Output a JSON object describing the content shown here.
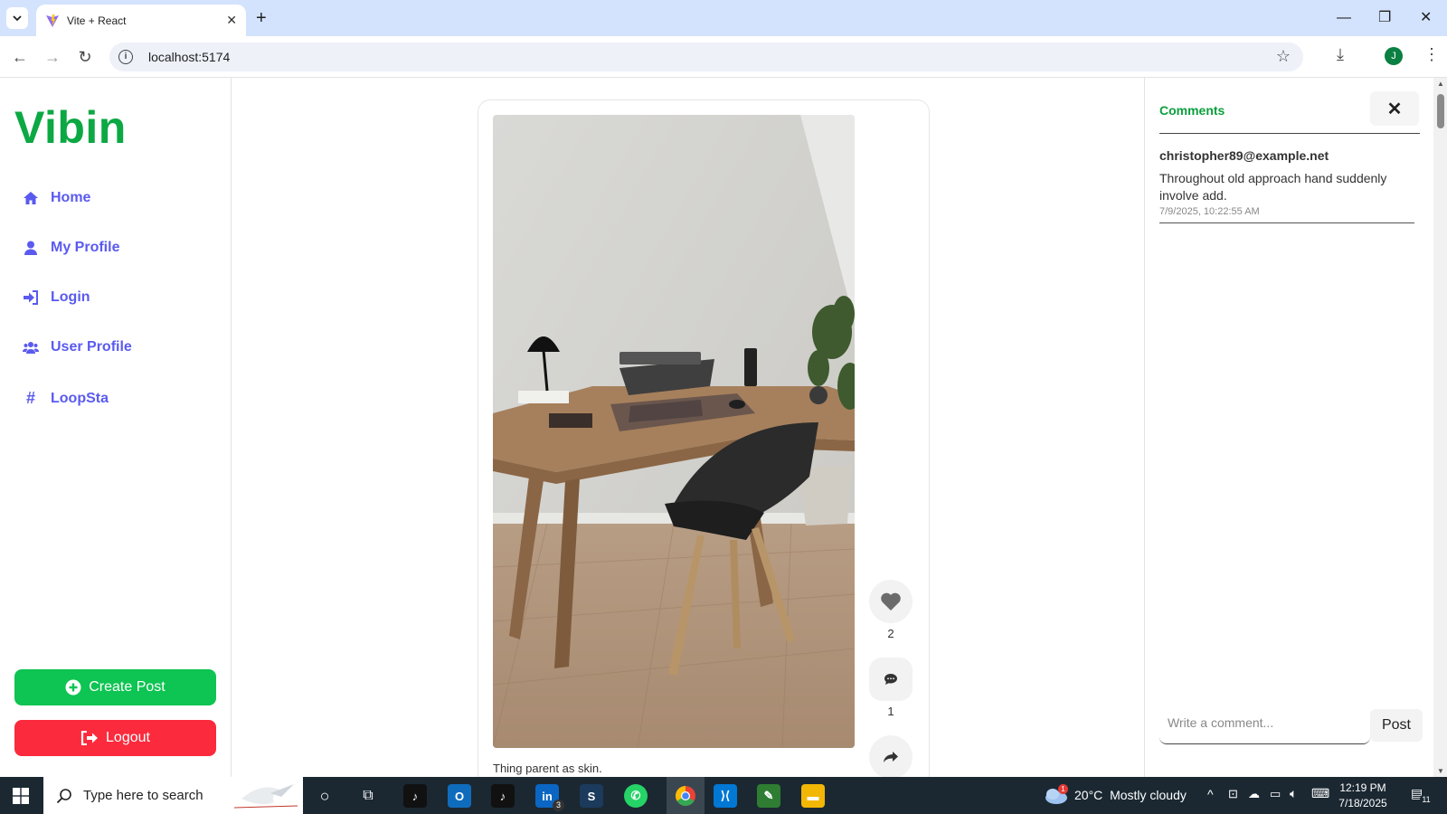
{
  "browser": {
    "tab_title": "Vite + React",
    "url": "localhost:5174",
    "profile_initial": "J"
  },
  "app": {
    "logo": "Vibin",
    "nav": [
      {
        "label": "Home",
        "icon": "home-icon"
      },
      {
        "label": "My Profile",
        "icon": "user-icon"
      },
      {
        "label": "Login",
        "icon": "sign-in-icon"
      },
      {
        "label": "User Profile",
        "icon": "users-icon"
      },
      {
        "label": "LoopSta",
        "icon": "hashtag-icon"
      }
    ],
    "create_post_label": "Create Post",
    "logout_label": "Logout"
  },
  "post": {
    "caption": "Thing parent as skin.",
    "like_count": "2",
    "comment_count": "1"
  },
  "comments_panel": {
    "title": "Comments",
    "comments": [
      {
        "author": "christopher89@example.net",
        "text": "Throughout old approach hand suddenly involve add.",
        "time": "7/9/2025, 10:22:55 AM"
      }
    ],
    "input_placeholder": "Write a comment...",
    "post_label": "Post"
  },
  "taskbar": {
    "search_placeholder": "Type here to search",
    "weather_temp": "20°C",
    "weather_desc": "Mostly cloudy",
    "weather_badge": "1",
    "time": "12:19 PM",
    "date": "7/18/2025",
    "notification_count": "11",
    "linkedin_badge": "3"
  },
  "colors": {
    "brand_green": "#0ca844",
    "nav_link": "#5a5af0",
    "create_post": "#0ec452",
    "logout": "#fb2a3c"
  }
}
